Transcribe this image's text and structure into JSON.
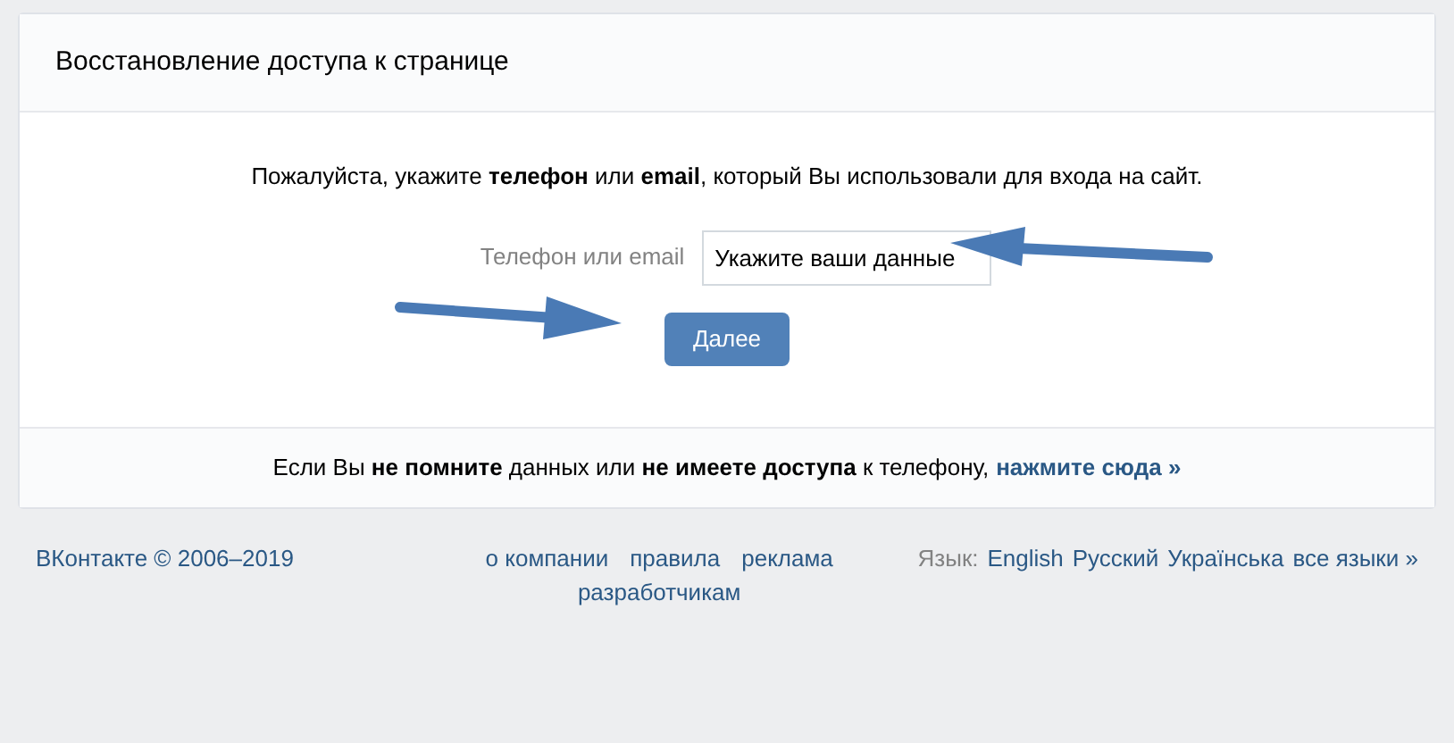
{
  "card": {
    "title": "Восстановление доступа к странице",
    "instruction": "Пожалуйста, укажите **телефон** или **email**, который Вы использовали для входа на сайт.",
    "field": {
      "label": "Телефон или email",
      "value": "Укажите ваши данные"
    },
    "button": "Далее",
    "help": {
      "text": "Если Вы **не помните** данных или **не имеете доступа** к телефону,",
      "link": "нажмите сюда »"
    }
  },
  "footer": {
    "copyright": "ВКонтакте © 2006–2019",
    "links": [
      "о компании",
      "правила",
      "реклама",
      "разработчикам"
    ],
    "language_label": "Язык:",
    "languages": [
      "English",
      "Русский",
      "Українська",
      "все языки »"
    ]
  }
}
